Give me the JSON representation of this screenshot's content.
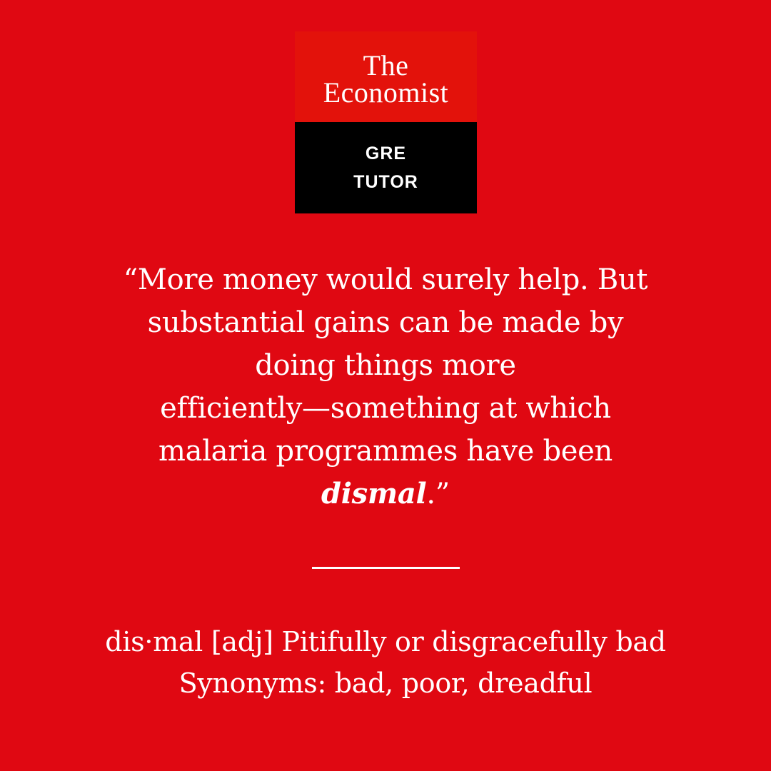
{
  "logo": {
    "brand_line1": "The",
    "brand_line2": "Economist",
    "product_line1": "GRE",
    "product_line2": "TUTOR"
  },
  "quote": {
    "lines": [
      "“More money would surely help. But",
      "substantial gains can be made by",
      "doing things more",
      "efficiently—something at which",
      "malaria programmes have been"
    ],
    "highlight_word": "dismal",
    "closing": ".”"
  },
  "definition": {
    "line": "dis·mal [adj] Pitifully or disgracefully bad",
    "synonyms": "Synonyms: bad, poor, dreadful"
  },
  "colors": {
    "background": "#e00812",
    "logo_red": "#e3120b",
    "logo_black": "#000000",
    "text": "#ffffff"
  }
}
